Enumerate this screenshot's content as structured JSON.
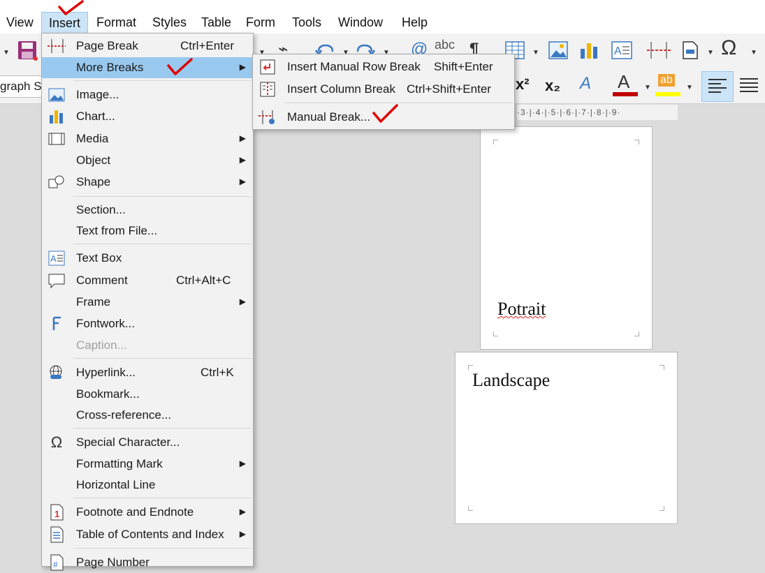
{
  "menubar": [
    "View",
    "Insert",
    "Format",
    "Styles",
    "Table",
    "Form",
    "Tools",
    "Window",
    "Help"
  ],
  "toolbar": {
    "para_style_value": "graph St",
    "icons": [
      "save-icon",
      "clear-formatting-icon",
      "undo-icon",
      "redo-icon",
      "find-replace-icon",
      "spelling-icon",
      "formatting-marks-icon",
      "insert-table-icon",
      "insert-image-icon",
      "insert-chart-icon",
      "insert-text-box-icon",
      "page-break-icon",
      "insert-field-icon",
      "special-character-icon",
      "superscript-icon",
      "subscript-icon",
      "character-highlight-icon",
      "font-color-icon",
      "highlighting-color-icon",
      "align-left-icon",
      "justify-icon"
    ],
    "colors": {
      "font_color": "#c00000",
      "highlight_color": "#ffff00",
      "active_bg": "#cce4f7"
    },
    "ruler_text": "·3·|·4·|·5·|·6·|·7·|·8·|·9·"
  },
  "insert_menu": {
    "items": [
      {
        "label": "Page Break",
        "shortcut": "Ctrl+Enter",
        "icon": "page-break-icon"
      },
      {
        "label": "More Breaks",
        "submenu": true
      },
      {
        "label": "Image...",
        "icon": "image-icon"
      },
      {
        "label": "Chart...",
        "icon": "chart-icon"
      },
      {
        "label": "Media",
        "icon": "media-icon",
        "submenu": true
      },
      {
        "label": "Object",
        "submenu": true
      },
      {
        "label": "Shape",
        "icon": "shape-icon",
        "submenu": true
      },
      {
        "label": "Section..."
      },
      {
        "label": "Text from File..."
      },
      {
        "label": "Text Box",
        "icon": "text-box-icon"
      },
      {
        "label": "Comment",
        "shortcut": "Ctrl+Alt+C",
        "icon": "comment-icon"
      },
      {
        "label": "Frame",
        "submenu": true
      },
      {
        "label": "Fontwork...",
        "icon": "fontwork-icon"
      },
      {
        "label": "Caption...",
        "disabled": true
      },
      {
        "label": "Hyperlink...",
        "shortcut": "Ctrl+K",
        "icon": "hyperlink-icon"
      },
      {
        "label": "Bookmark..."
      },
      {
        "label": "Cross-reference..."
      },
      {
        "label": "Special Character...",
        "icon": "omega-icon"
      },
      {
        "label": "Formatting Mark",
        "submenu": true
      },
      {
        "label": "Horizontal Line"
      },
      {
        "label": "Footnote and Endnote",
        "icon": "footnote-icon",
        "submenu": true
      },
      {
        "label": "Table of Contents and Index",
        "icon": "toc-icon",
        "submenu": true
      },
      {
        "label": "Page Number",
        "icon": "page-number-icon"
      }
    ]
  },
  "more_breaks_submenu": {
    "items": [
      {
        "label": "Insert Manual Row Break",
        "shortcut": "Shift+Enter",
        "icon": "row-break-icon"
      },
      {
        "label": "Insert Column Break",
        "shortcut": "Ctrl+Shift+Enter",
        "icon": "column-break-icon"
      },
      {
        "label": "Manual Break...",
        "icon": "manual-break-icon"
      }
    ]
  },
  "document": {
    "page1_text": "Potrait",
    "page2_text": "Landscape"
  },
  "annotations": {
    "check_color": "#e00000"
  }
}
